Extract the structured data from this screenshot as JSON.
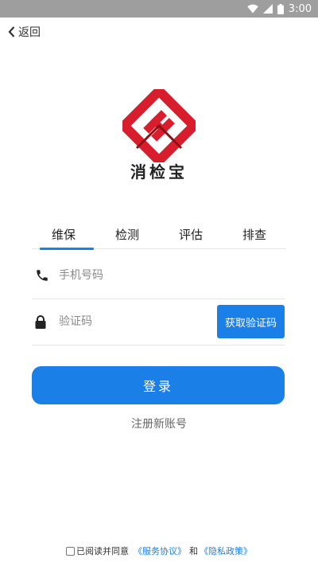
{
  "status_bar": {
    "time": "3:00"
  },
  "nav": {
    "back_label": "返回"
  },
  "brand": {
    "name": "消检宝",
    "logo_colors": {
      "red": "#d81e2c",
      "dark_red": "#8c1018"
    }
  },
  "tabs": [
    {
      "label": "维保",
      "active": true
    },
    {
      "label": "检测",
      "active": false
    },
    {
      "label": "评估",
      "active": false
    },
    {
      "label": "排查",
      "active": false
    }
  ],
  "form": {
    "phone_placeholder": "手机号码",
    "phone_value": "",
    "code_placeholder": "验证码",
    "code_value": "",
    "get_code_label": "获取验证码"
  },
  "login_label": "登录",
  "register_label": "注册新账号",
  "agreement": {
    "prefix": "已阅读并同意",
    "service_link": "《服务协议》",
    "connector": "和",
    "privacy_link": "《隐私政策》",
    "checked": false
  },
  "colors": {
    "accent": "#1a7fe6",
    "status_bar": "#9e9e9e"
  }
}
